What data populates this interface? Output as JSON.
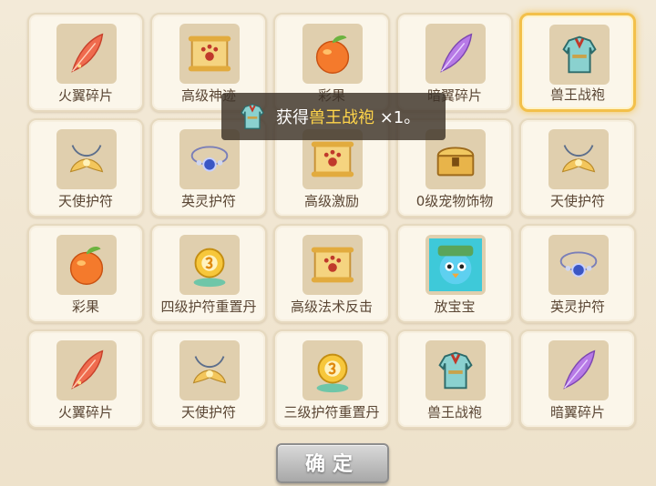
{
  "items": [
    {
      "name": "火翼碎片",
      "icon": "red-feather-icon"
    },
    {
      "name": "高级神迹",
      "icon": "scroll-paw-icon"
    },
    {
      "name": "彩果",
      "icon": "peach-fruit-icon"
    },
    {
      "name": "暗翼碎片",
      "icon": "purple-feather-icon"
    },
    {
      "name": "兽王战袍",
      "icon": "robe-icon"
    },
    {
      "name": "天使护符",
      "icon": "angel-amulet-icon"
    },
    {
      "name": "英灵护符",
      "icon": "spirit-amulet-icon"
    },
    {
      "name": "高级激励",
      "icon": "scroll-paw-icon"
    },
    {
      "name": "0级宠物饰物",
      "icon": "treasure-chest-icon"
    },
    {
      "name": "天使护符",
      "icon": "angel-amulet-icon"
    },
    {
      "name": "彩果",
      "icon": "peach-fruit-icon"
    },
    {
      "name": "四级护符重置丹",
      "icon": "reset-pill-icon"
    },
    {
      "name": "高级法术反击",
      "icon": "scroll-paw-icon"
    },
    {
      "name": "放宝宝",
      "icon": "pet-bird-icon"
    },
    {
      "name": "英灵护符",
      "icon": "spirit-amulet-icon"
    },
    {
      "name": "火翼碎片",
      "icon": "red-feather-icon"
    },
    {
      "name": "天使护符",
      "icon": "angel-amulet-icon"
    },
    {
      "name": "三级护符重置丹",
      "icon": "reset-pill-icon"
    },
    {
      "name": "兽王战袍",
      "icon": "robe-icon"
    },
    {
      "name": "暗翼碎片",
      "icon": "purple-feather-icon"
    }
  ],
  "selected_index": 4,
  "toast": {
    "prefix": "获得",
    "item": "兽王战袍",
    "suffix": " ×1。",
    "icon": "robe-icon"
  },
  "confirm_label": "确定",
  "colors": {
    "panel": "#efe4cf",
    "cell": "#fbf6ea",
    "icon_bg": "#e0cfae",
    "selected_border": "#f3c04a",
    "label_text": "#5a4634",
    "highlight": "#ffd54a"
  }
}
